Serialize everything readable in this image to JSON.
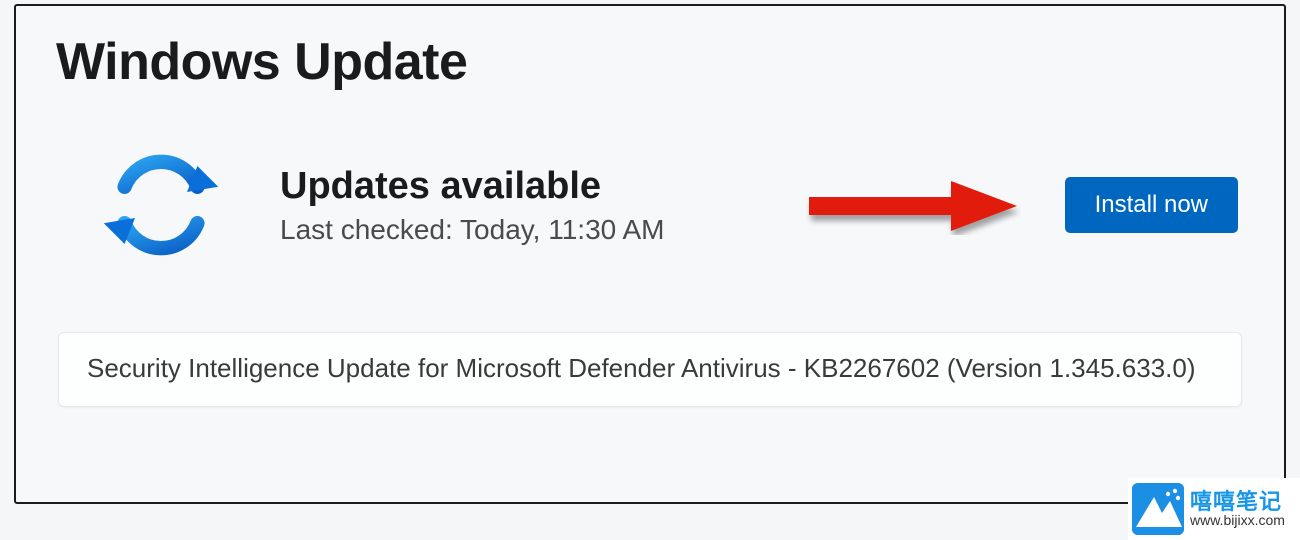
{
  "header": {
    "title": "Windows Update"
  },
  "status": {
    "heading": "Updates available",
    "last_checked": "Last checked: Today, 11:30 AM"
  },
  "actions": {
    "install_label": "Install now"
  },
  "updates": [
    {
      "title": "Security Intelligence Update for Microsoft Defender Antivirus - KB2267602 (Version 1.345.633.0)"
    }
  ],
  "icons": {
    "sync": "sync-icon",
    "arrow": "annotation-arrow"
  },
  "colors": {
    "accent": "#0067c0",
    "icon_blue": "#0a6fd8",
    "arrow_red": "#e11b0c"
  },
  "watermark": {
    "brand_cn": "嘻嘻笔记",
    "url": "www.bijixx.com"
  }
}
